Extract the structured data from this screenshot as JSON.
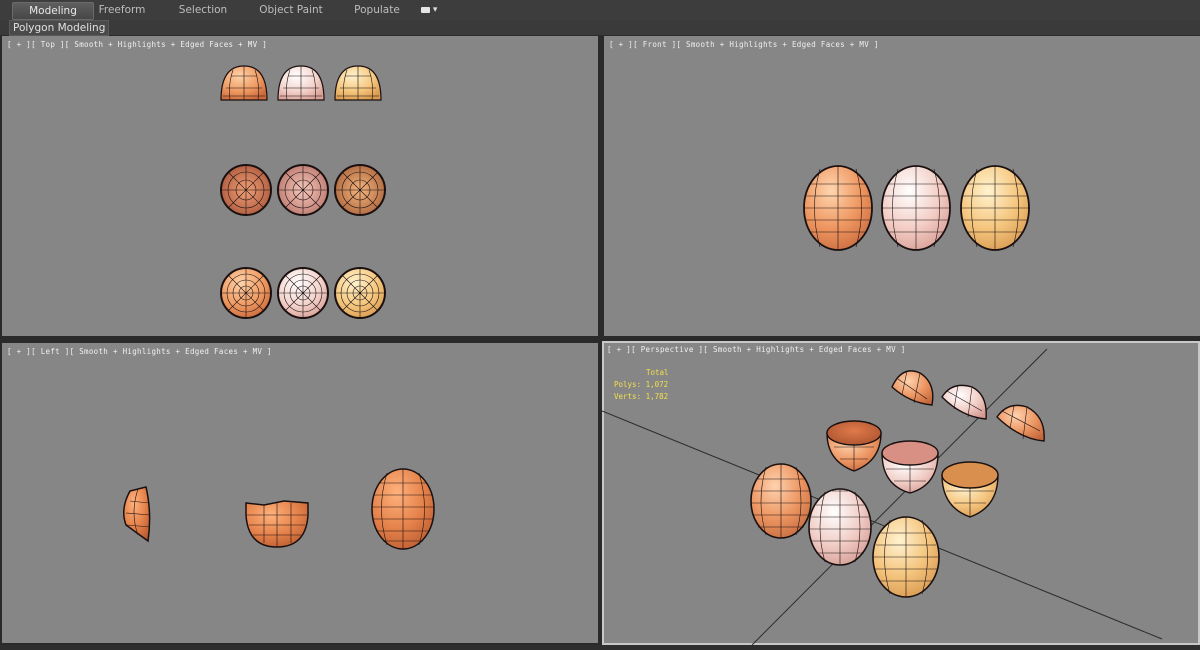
{
  "ribbon": {
    "tabs": [
      {
        "label": "Modeling",
        "active": true
      },
      {
        "label": "Freeform",
        "active": false
      },
      {
        "label": "Selection",
        "active": false
      },
      {
        "label": "Object Paint",
        "active": false
      },
      {
        "label": "Populate",
        "active": false
      }
    ],
    "dropdown_icon": "camera-dropdown-icon"
  },
  "subpanel": {
    "label": "Polygon Modeling"
  },
  "viewports": {
    "top": {
      "label": "[ + ][ Top ][ Smooth + Highlights + Edged Faces + MV ]"
    },
    "front": {
      "label": "[ + ][ Front ][ Smooth + Highlights + Edged Faces + MV ]"
    },
    "left": {
      "label": "[ + ][ Left ][ Smooth + Highlights + Edged Faces + MV ]"
    },
    "perspective": {
      "label": "[ + ][ Perspective ][ Smooth + Highlights + Edged Faces + MV ]",
      "stats": {
        "total": "Total",
        "polys": "Polys: 1,072",
        "verts": "Verts: 1,782"
      }
    }
  },
  "colors": {
    "viewport_bg": "#868686",
    "egg_orange": "#e8935f",
    "egg_pink": "#f4cfc8",
    "egg_yellow": "#f3c983",
    "wire": "#1a1010",
    "stats_text": "#f2e04a"
  }
}
